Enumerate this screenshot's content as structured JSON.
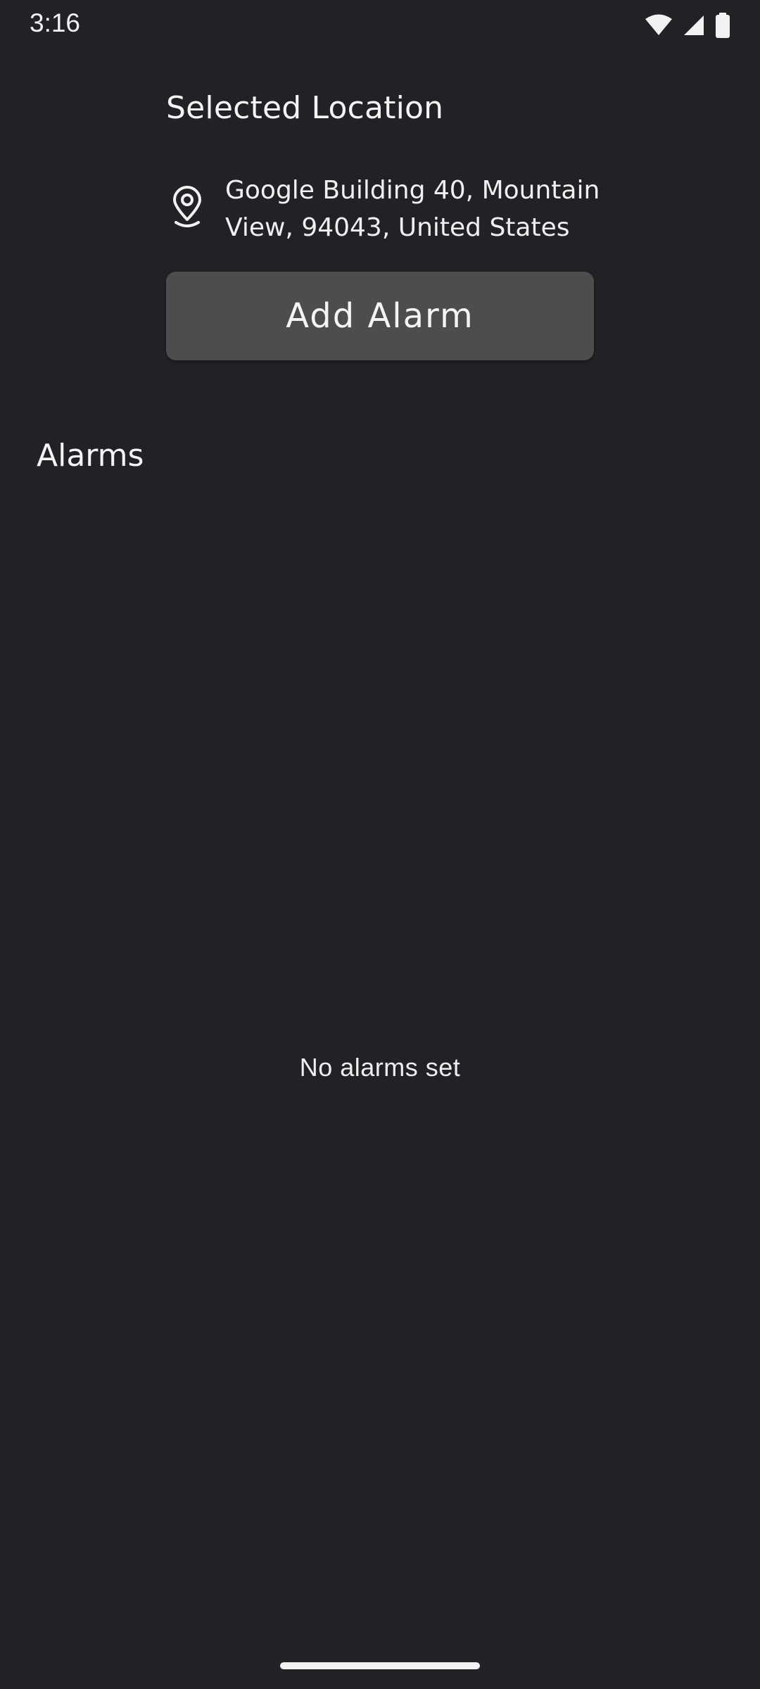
{
  "status_bar": {
    "time": "3:16",
    "icons": [
      "wifi-icon",
      "cellular-signal-icon",
      "battery-icon"
    ]
  },
  "location": {
    "section_title": "Selected Location",
    "address": "Google Building 40, Mountain View, 94043, United States",
    "icon": "location-pin-icon"
  },
  "actions": {
    "add_alarm_label": "Add Alarm"
  },
  "alarms": {
    "heading": "Alarms",
    "empty_message": "No alarms set",
    "items": []
  },
  "colors": {
    "background": "#212226",
    "button": "#4d4d4d",
    "text": "#f2f2f2"
  }
}
